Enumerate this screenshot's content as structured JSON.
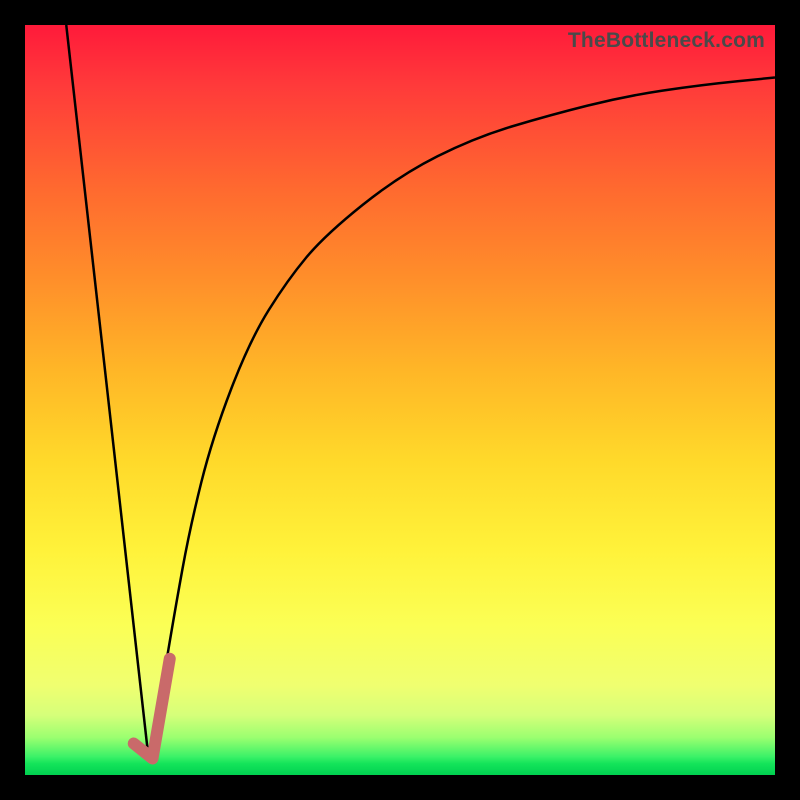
{
  "watermark": "TheBottleneck.com",
  "chart_data": {
    "type": "line",
    "title": "",
    "xlabel": "",
    "ylabel": "",
    "xlim": [
      0,
      100
    ],
    "ylim": [
      0,
      100
    ],
    "grid": false,
    "legend": false,
    "series": [
      {
        "name": "left-slope",
        "stroke": "#000000",
        "stroke_width": 2.5,
        "x": [
          5.5,
          16.5
        ],
        "y": [
          100,
          2
        ]
      },
      {
        "name": "right-curve",
        "stroke": "#000000",
        "stroke_width": 2.5,
        "x": [
          16.5,
          18,
          20,
          22,
          25,
          30,
          35,
          40,
          50,
          60,
          70,
          80,
          90,
          100
        ],
        "y": [
          2,
          10,
          22,
          33,
          45,
          58,
          66,
          72,
          80,
          85,
          88,
          90.5,
          92,
          93
        ]
      },
      {
        "name": "tick-mark",
        "stroke": "#c96a6a",
        "stroke_width": 12,
        "linecap": "round",
        "x": [
          14.5,
          17,
          19.3
        ],
        "y": [
          4.2,
          2.2,
          15.5
        ]
      }
    ],
    "gradient_stops": [
      {
        "pos": 0,
        "color": "#ff1a3a"
      },
      {
        "pos": 0.5,
        "color": "#ffd92a"
      },
      {
        "pos": 0.92,
        "color": "#d6ff7a"
      },
      {
        "pos": 1.0,
        "color": "#00d050"
      }
    ]
  }
}
